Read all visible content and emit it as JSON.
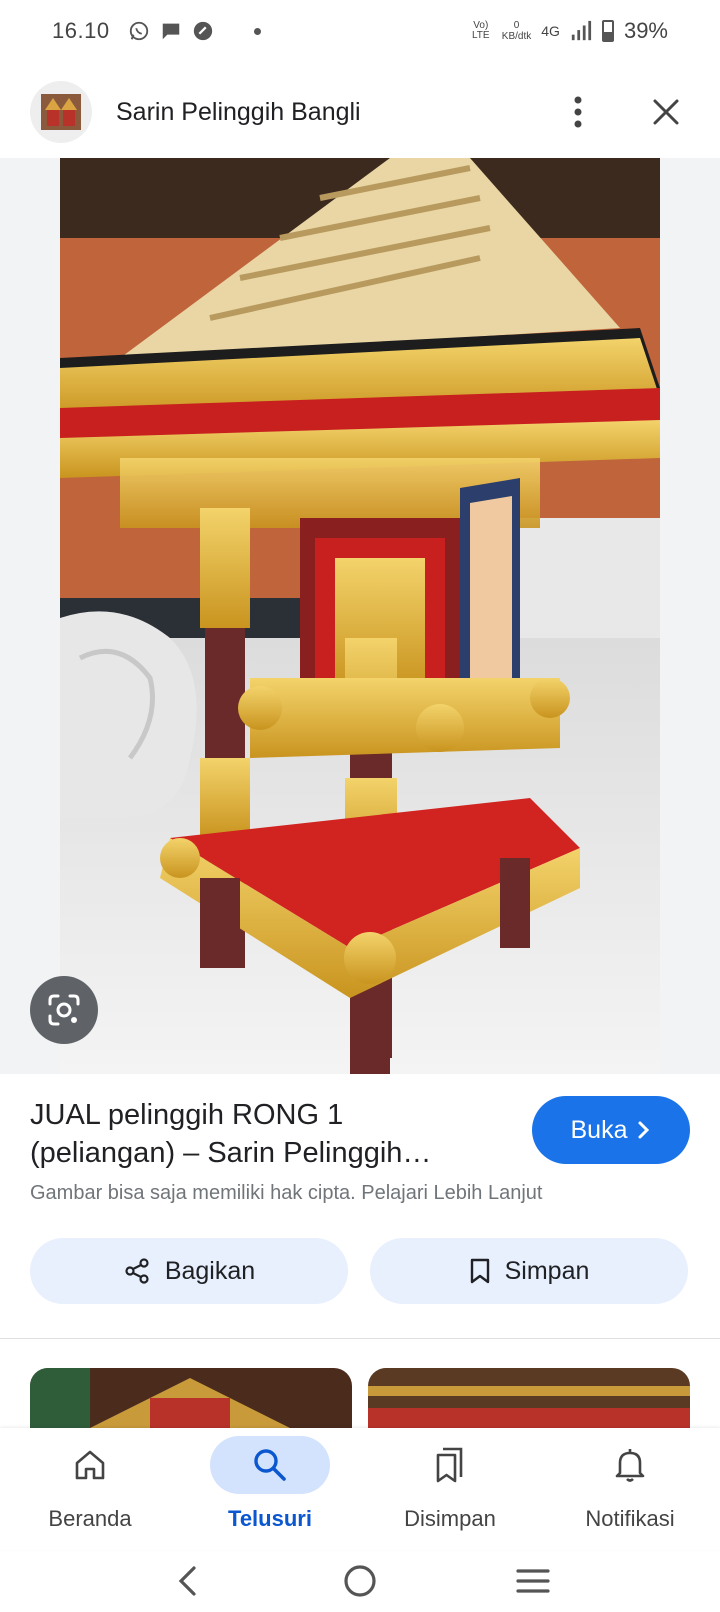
{
  "status_bar": {
    "time": "16.10",
    "network_label": "Vo) LTE",
    "speed_value": "0",
    "speed_unit": "KB/dtk",
    "network_type": "4G",
    "battery": "39%"
  },
  "header": {
    "title": "Sarin Pelinggih Bangli"
  },
  "result": {
    "title": "JUAL pelinggih RONG 1 (peliangan) – Sarin Pelinggih…",
    "open_label": "Buka",
    "copyright_notice": "Gambar bisa saja memiliki hak cipta. Pelajari Lebih Lanjut",
    "share_label": "Bagikan",
    "save_label": "Simpan"
  },
  "bottom_nav": {
    "items": [
      {
        "label": "Beranda",
        "icon": "home-icon",
        "active": false
      },
      {
        "label": "Telusuri",
        "icon": "search-icon",
        "active": true
      },
      {
        "label": "Disimpan",
        "icon": "collections-icon",
        "active": false
      },
      {
        "label": "Notifikasi",
        "icon": "bell-icon",
        "active": false
      }
    ]
  },
  "colors": {
    "accent": "#1a73e8",
    "tonal_button": "#e8f0fe",
    "active_nav": "#0b57d0"
  }
}
